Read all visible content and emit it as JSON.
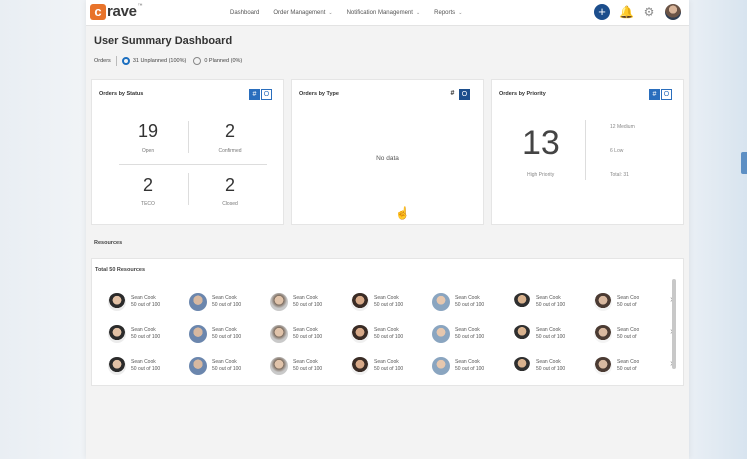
{
  "logo": {
    "first": "c",
    "rest": "rave",
    "tm": "™"
  },
  "nav": [
    {
      "label": "Dashboard",
      "chevron": false
    },
    {
      "label": "Order Management",
      "chevron": true
    },
    {
      "label": "Notification Management",
      "chevron": true
    },
    {
      "label": "Reports",
      "chevron": true
    }
  ],
  "page_title": "User Summary Dashboard",
  "filters": {
    "label": "Orders",
    "options": [
      {
        "label": "31 Unplanned (100%)",
        "selected": true
      },
      {
        "label": "0 Planned (0%)",
        "selected": false
      }
    ]
  },
  "cards": {
    "status": {
      "title": "Orders by Status",
      "stats": [
        {
          "value": "19",
          "label": "Open"
        },
        {
          "value": "2",
          "label": "Confirmed"
        },
        {
          "value": "2",
          "label": "TECO"
        },
        {
          "value": "2",
          "label": "Closed"
        }
      ]
    },
    "type": {
      "title": "Orders by Type",
      "empty": "No data"
    },
    "priority": {
      "title": "Orders by Priority",
      "big_value": "13",
      "big_label": "High Priority",
      "lines": [
        "12 Medium",
        "6 Low",
        "Total: 31"
      ]
    }
  },
  "toggle": {
    "chart": "#",
    "refresh": "O"
  },
  "resources": {
    "section_title": "Resources",
    "total": "Total 50 Resources",
    "rows": [
      [
        {
          "name": "Sean Cook",
          "detail": "50 out of 100"
        },
        {
          "name": "Sean Cook",
          "detail": "50 out of 100"
        },
        {
          "name": "Sean Cook",
          "detail": "50 out of 100"
        },
        {
          "name": "Sean Cook",
          "detail": "50 out of 100"
        },
        {
          "name": "Sean Cook",
          "detail": "50 out of 100"
        },
        {
          "name": "Sean Cook",
          "detail": "50 out of 100"
        },
        {
          "name": "Sean Coo",
          "detail": "50 out of"
        }
      ],
      [
        {
          "name": "Sean Cook",
          "detail": "50 out of 100"
        },
        {
          "name": "Sean Cook",
          "detail": "50 out of 100"
        },
        {
          "name": "Sean Cook",
          "detail": "50 out of 100"
        },
        {
          "name": "Sean Cook",
          "detail": "50 out of 100"
        },
        {
          "name": "Sean Cook",
          "detail": "50 out of 100"
        },
        {
          "name": "Sean Cook",
          "detail": "50 out of 100"
        },
        {
          "name": "Sean Coo",
          "detail": "50 out of"
        }
      ],
      [
        {
          "name": "Sean Cook",
          "detail": "50 out of 100"
        },
        {
          "name": "Sean Cook",
          "detail": "50 out of 100"
        },
        {
          "name": "Sean Cook",
          "detail": "50 out of 100"
        },
        {
          "name": "Sean Cook",
          "detail": "50 out of 100"
        },
        {
          "name": "Sean Cook",
          "detail": "50 out of 100"
        },
        {
          "name": "Sean Cook",
          "detail": "50 out of 100"
        },
        {
          "name": "Sean Coo",
          "detail": "50 out of"
        }
      ]
    ],
    "next_glyph": "›"
  },
  "icons": {
    "plus": "+",
    "bell": "🔔",
    "gear": "⚙",
    "nav_chevron": "⌄",
    "cursor": "☝"
  },
  "colors": {
    "accent": "#2a6ebd",
    "dark_accent": "#1c4e8c",
    "logo": "#e8732a"
  }
}
